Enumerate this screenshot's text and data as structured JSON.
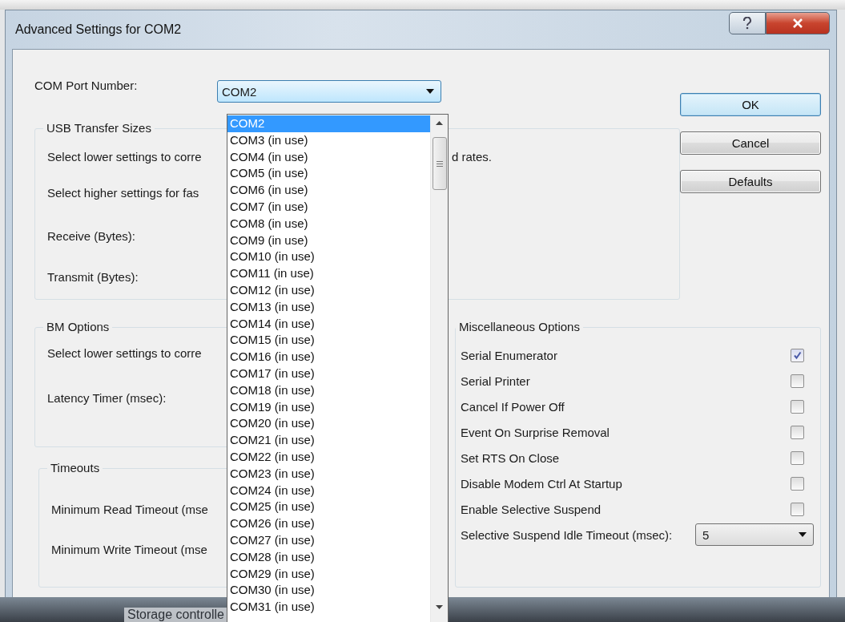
{
  "window": {
    "title": "Advanced Settings for COM2"
  },
  "com_port": {
    "label": "COM Port Number:",
    "value": "COM2",
    "open": true
  },
  "buttons": [
    {
      "label": "OK",
      "default": true
    },
    {
      "label": "Cancel",
      "default": false
    },
    {
      "label": "Defaults",
      "default": false
    }
  ],
  "usb_transfer": {
    "title": "USB Transfer Sizes",
    "line_1": "Select lower settings to corre",
    "line_1_end": "d rates.",
    "line_2": "Select higher settings for fas",
    "receive_label": "Receive (Bytes):",
    "transmit_label": "Transmit (Bytes):"
  },
  "bm_options": {
    "title": "BM Options",
    "text": "Select lower settings to corre",
    "latency_label": "Latency Timer (msec):"
  },
  "timeouts": {
    "title": "Timeouts",
    "read_label": "Minimum Read Timeout (mse",
    "write_label": "Minimum Write Timeout (mse"
  },
  "misc_options": {
    "title": "Miscellaneous Options",
    "items": [
      {
        "label": "Serial Enumerator",
        "checked": true
      },
      {
        "label": "Serial Printer",
        "checked": false
      },
      {
        "label": "Cancel If Power Off",
        "checked": false
      },
      {
        "label": "Event On Surprise Removal",
        "checked": false
      },
      {
        "label": "Set RTS On Close",
        "checked": false
      },
      {
        "label": "Disable Modem Ctrl At Startup",
        "checked": false
      },
      {
        "label": "Enable Selective Suspend",
        "checked": false
      }
    ],
    "idle_timeout": {
      "label": "Selective Suspend Idle Timeout (msec):",
      "value": "5"
    }
  },
  "dropdown_list": [
    {
      "label": "COM2",
      "selected": true
    },
    {
      "label": "COM3 (in use)",
      "selected": false
    },
    {
      "label": "COM4 (in use)",
      "selected": false
    },
    {
      "label": "COM5 (in use)",
      "selected": false
    },
    {
      "label": "COM6 (in use)",
      "selected": false
    },
    {
      "label": "COM7 (in use)",
      "selected": false
    },
    {
      "label": "COM8 (in use)",
      "selected": false
    },
    {
      "label": "COM9 (in use)",
      "selected": false
    },
    {
      "label": "COM10 (in use)",
      "selected": false
    },
    {
      "label": "COM11 (in use)",
      "selected": false
    },
    {
      "label": "COM12 (in use)",
      "selected": false
    },
    {
      "label": "COM13 (in use)",
      "selected": false
    },
    {
      "label": "COM14 (in use)",
      "selected": false
    },
    {
      "label": "COM15 (in use)",
      "selected": false
    },
    {
      "label": "COM16 (in use)",
      "selected": false
    },
    {
      "label": "COM17 (in use)",
      "selected": false
    },
    {
      "label": "COM18 (in use)",
      "selected": false
    },
    {
      "label": "COM19 (in use)",
      "selected": false
    },
    {
      "label": "COM20 (in use)",
      "selected": false
    },
    {
      "label": "COM21 (in use)",
      "selected": false
    },
    {
      "label": "COM22 (in use)",
      "selected": false
    },
    {
      "label": "COM23 (in use)",
      "selected": false
    },
    {
      "label": "COM24 (in use)",
      "selected": false
    },
    {
      "label": "COM25 (in use)",
      "selected": false
    },
    {
      "label": "COM26 (in use)",
      "selected": false
    },
    {
      "label": "COM27 (in use)",
      "selected": false
    },
    {
      "label": "COM28 (in use)",
      "selected": false
    },
    {
      "label": "COM29 (in use)",
      "selected": false
    },
    {
      "label": "COM30 (in use)",
      "selected": false
    },
    {
      "label": "COM31 (in use)",
      "selected": false
    }
  ],
  "background": {
    "text": "Storage controlle"
  }
}
